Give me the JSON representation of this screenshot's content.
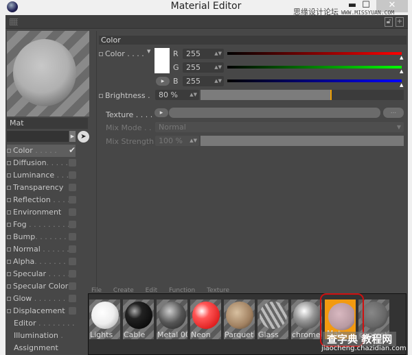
{
  "window": {
    "title": "Material Editor",
    "minimize": "▬",
    "maximize": "☐",
    "close": "✕"
  },
  "watermarks": {
    "top_cn": "思缘设计论坛",
    "top_url": "WWW.MISSYUAN.COM",
    "bottom_cn": "查字典 教程网",
    "bottom_url": "jiaocheng.chazidian.com"
  },
  "material": {
    "name": "Mat"
  },
  "channels": [
    {
      "label": "Color",
      "dots": " . . . . .",
      "enabled": true,
      "selected": true
    },
    {
      "label": "Diffusion",
      "dots": ". . . . .",
      "enabled": false
    },
    {
      "label": "Luminance",
      "dots": " . . . .",
      "enabled": false
    },
    {
      "label": "Transparency",
      "dots": "",
      "enabled": false
    },
    {
      "label": "Reflection",
      "dots": " . . . .",
      "enabled": false
    },
    {
      "label": "Environment",
      "dots": "",
      "enabled": false
    },
    {
      "label": "Fog",
      "dots": " . . . . . . . . .",
      "enabled": false
    },
    {
      "label": "Bump",
      "dots": ". . . . . . . .",
      "enabled": false
    },
    {
      "label": "Normal",
      "dots": " . . . . . . .",
      "enabled": false
    },
    {
      "label": "Alpha",
      "dots": ". . . . . . . .",
      "enabled": false
    },
    {
      "label": "Specular",
      "dots": " . . . . . .",
      "enabled": false
    },
    {
      "label": "Specular Color",
      "dots": "",
      "enabled": false
    },
    {
      "label": "Glow",
      "dots": " . . . . . . . . .",
      "enabled": false
    },
    {
      "label": "Displacement",
      "dots": "",
      "enabled": false
    },
    {
      "label": "Editor",
      "dots": " . . . . . . . .",
      "checkbox": false
    },
    {
      "label": "Illumination",
      "dots": " .",
      "checkbox": false
    },
    {
      "label": "Assignment",
      "dots": "",
      "checkbox": false
    }
  ],
  "color_section": {
    "title": "Color",
    "color_label": "Color . . . .",
    "swatch_color": "#ffffff",
    "r_label": "R",
    "r": "255",
    "g_label": "G",
    "g": "255",
    "b_label": "B",
    "b": "255",
    "brightness_label": "Brightness .",
    "brightness": "80 %",
    "brightness_value": 80,
    "texture_label": "Texture . . . .",
    "texture_more": "...",
    "mix_mode_label": "Mix Mode . .",
    "mix_mode": "Normal",
    "mix_strength_label": "Mix Strength",
    "mix_strength": "100 %",
    "accent": "#f0a000"
  },
  "browser": {
    "menu": "File Create Edit Function Texture",
    "materials": [
      {
        "label": "Lights",
        "ball": "radial-gradient(circle at 40% 40%,#fff 0,#eee 50%,#999 100%)"
      },
      {
        "label": "Cable",
        "ball": "radial-gradient(circle at 35% 35%,#aaa 0,#222 30%,#000 100%)"
      },
      {
        "label": "Metal 00",
        "ball": "radial-gradient(circle at 40% 35%,#ccc 0,#555 50%,#222 100%)"
      },
      {
        "label": "Neon",
        "ball": "radial-gradient(circle at 35% 35%,#fff 0,#f55 30%,#c00 100%)"
      },
      {
        "label": "Parquet",
        "ball": "radial-gradient(circle at 40% 40%,#d8c0a0 0,#a08060 60%,#4a3a2a 100%)"
      },
      {
        "label": "Glass",
        "ball": "repeating-linear-gradient(60deg,#bbb 0 4px,#666 4px 8px)"
      },
      {
        "label": "chrome",
        "ball": "radial-gradient(circle at 40% 35%,#fff 0,#999 40%,#333 100%)"
      },
      {
        "label": "Mat",
        "ball": "radial-gradient(circle at 40% 40%,#d8b8c0 0,#b89aa2 60%,#6a5a60 100%)",
        "selected": true
      },
      {
        "label": "concret",
        "ball": "radial-gradient(circle at 40% 40%,#888 0,#666 60%,#333 100%)"
      }
    ]
  }
}
